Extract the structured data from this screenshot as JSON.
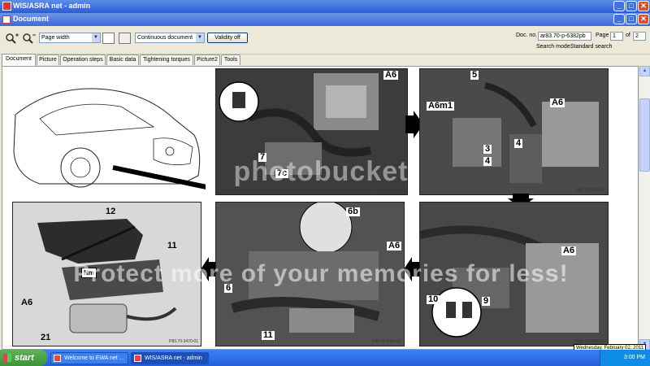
{
  "window": {
    "title": "WIS/ASRA net - admin",
    "minimize": "_",
    "maximize": "□",
    "close": "✕"
  },
  "document_window": {
    "title": "Document",
    "minimize": "_",
    "maximize": "□",
    "close": "✕"
  },
  "toolbar": {
    "zoom_in_icon": "zoom-in-icon",
    "zoom_out_icon": "zoom-out-icon",
    "zoom_mode": "Page width",
    "view_mode": "Continuous document",
    "validity_button": "Validity off",
    "doc_no_label": "Doc. no.",
    "doc_no_value": "ar83.70-p-6382pb",
    "page_label": "Page",
    "page_value": "1",
    "of_label": "of",
    "page_total": "2",
    "search_mode_label": "Search mode:",
    "search_mode_value": "Standard search"
  },
  "tabs": [
    {
      "label": "Document",
      "active": true
    },
    {
      "label": "Picture",
      "active": false
    },
    {
      "label": "Operation steps",
      "active": false
    },
    {
      "label": "Basic data",
      "active": false
    },
    {
      "label": "Tightening torques",
      "active": false
    },
    {
      "label": "Picture2",
      "active": false
    },
    {
      "label": "Tools",
      "active": false
    }
  ],
  "figures": {
    "top_middle": {
      "labels": [
        "A6",
        "7",
        "7c"
      ],
      "ref": "P83.70-3460-01"
    },
    "top_right": {
      "labels": [
        "5",
        "A6m1",
        "A6",
        "3",
        "4",
        "4"
      ],
      "ref": "P83.70-3461-01"
    },
    "bottom_left": {
      "labels": [
        "12",
        "11",
        "Nm",
        "A6",
        "21"
      ],
      "ref": "P83.70-3470-01"
    },
    "bottom_middle": {
      "labels": [
        "6b",
        "A6",
        "6",
        "11"
      ],
      "ref": "P83.70-3469-01"
    },
    "bottom_right": {
      "labels": [
        "A6",
        "10",
        "9"
      ],
      "ref": "P83.70-3468-01"
    }
  },
  "watermark": {
    "top": "photobucket",
    "bottom": "Protect more of your memories for less!"
  },
  "taskbar": {
    "start": "start",
    "tasks": [
      {
        "label": "Welcome to EWA net ...",
        "active": false
      },
      {
        "label": "WIS/ASRA net - admin",
        "active": true
      }
    ],
    "clock": "3:00 PM",
    "tooltip": "Wednesday, February 02, 2011"
  },
  "colors": {
    "titlebar": "#2a5bd7",
    "start_button": "#3a9434",
    "panel_bg": "#d8d8d8"
  }
}
